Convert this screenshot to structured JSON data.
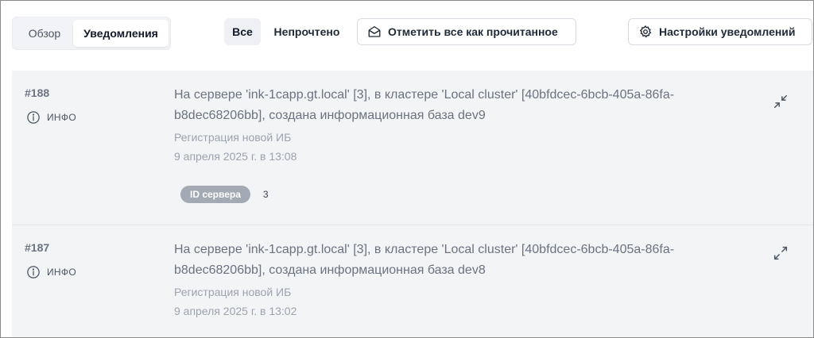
{
  "tabs": {
    "overview": "Обзор",
    "notifications": "Уведомления"
  },
  "filters": {
    "all": "Все",
    "unread": "Непрочтено"
  },
  "actions": {
    "mark_all_read": "Отметить все как прочитанное",
    "settings": "Настройки уведомлений"
  },
  "notifications": [
    {
      "id": "#188",
      "level": "ИНФО",
      "text": "На сервере 'ink-1capp.gt.local' [3], в кластере 'Local cluster' [40bfdcec-6bcb-405a-86fa-b8dec68206bb], создана информационная база dev9",
      "source": "Регистрация новой ИБ",
      "date": "9 апреля 2025 г. в 13:08",
      "tag_label": "ID сервера",
      "tag_value": "3"
    },
    {
      "id": "#187",
      "level": "ИНФО",
      "text": "На сервере 'ink-1capp.gt.local' [3], в кластере 'Local cluster' [40bfdcec-6bcb-405a-86fa-b8dec68206bb], создана информационная база dev8",
      "source": "Регистрация новой ИБ",
      "date": "9 апреля 2025 г. в 13:02"
    }
  ],
  "colors": {
    "list_bg": "#f3f4f6",
    "tag_bg": "#a3aab4",
    "text_muted": "#6b7280"
  }
}
